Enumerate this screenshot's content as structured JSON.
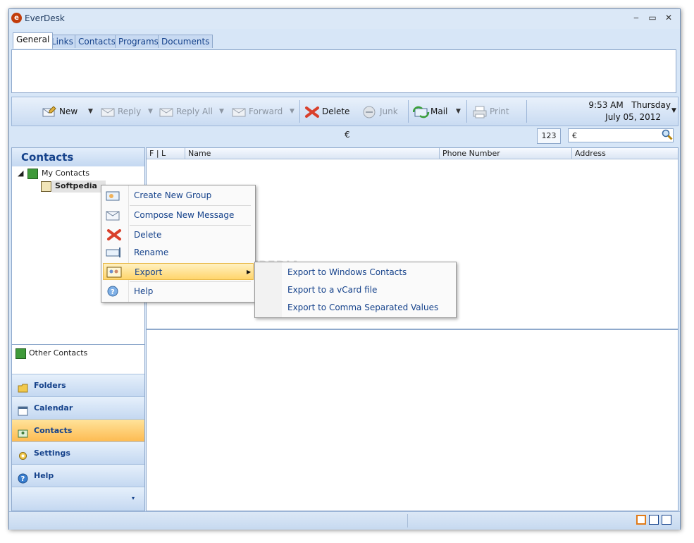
{
  "window": {
    "title": "EverDesk",
    "minimize": "‒",
    "maximize": "▭",
    "close": "✕"
  },
  "tabs": [
    "General",
    "Links",
    "Contacts",
    "Programs",
    "Documents"
  ],
  "toolbar": {
    "new": "New",
    "reply": "Reply",
    "reply_all": "Reply All",
    "forward": "Forward",
    "delete": "Delete",
    "junk": "Junk",
    "mail": "Mail",
    "print": "Print",
    "time": "9:53 AM",
    "day": "Thursday",
    "date": "July 05, 2012"
  },
  "searchbar": {
    "euro": "€",
    "count_button": "123",
    "search_value": "€"
  },
  "left": {
    "header": "Contacts",
    "tree_root": "My Contacts",
    "tree_child": "Softpedia",
    "other_contacts": "Other Contacts",
    "nav": [
      "Folders",
      "Calendar",
      "Contacts",
      "Settings",
      "Help"
    ]
  },
  "grid": {
    "columns": [
      "F | L",
      "Name",
      "Phone Number",
      "Address"
    ]
  },
  "context_menu": {
    "items": [
      "Create New Group",
      "Compose New Message",
      "Delete",
      "Rename",
      "Export",
      "Help"
    ]
  },
  "export_submenu": {
    "items": [
      "Export to Windows Contacts",
      "Export to a vCard file",
      "Export to Comma Separated Values"
    ]
  },
  "watermark": {
    "text": "SOFTPEDIA",
    "url": "www.softpedia.com"
  },
  "colors": {
    "accent": "#15428b",
    "highlight": "#ffd56b",
    "nav_active": "#fdbb52",
    "delete_red": "#d9402b"
  }
}
